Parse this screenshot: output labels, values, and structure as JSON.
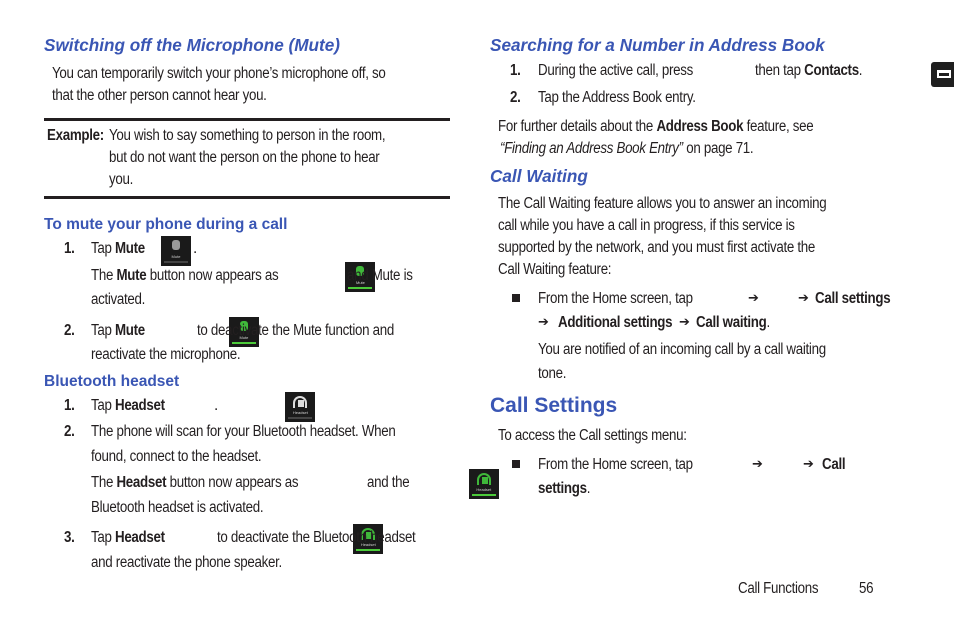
{
  "left": {
    "mute_section": {
      "heading": "Switching off the Microphone (Mute)",
      "intro_line1": "You can temporarily switch your phone’s microphone off, so",
      "intro_line2": "that the other person cannot hear you.",
      "example_label": "Example:",
      "example_line1": "You wish to say something to person in the room,",
      "example_line2": "but do not want the person on the phone to hear",
      "example_line3": "you."
    },
    "mute_steps": {
      "heading": "To mute your phone during a call",
      "step1_num": "1.",
      "step1_pre": "Tap ",
      "step1_bold": "Mute",
      "step1_post": ".",
      "step1_note_pre": "The ",
      "step1_note_bold": "Mute",
      "step1_note_mid": " button now appears as",
      "step1_note_post": "and Mute is",
      "step1_note_line2": "activated.",
      "step2_num": "2.",
      "step2_pre": "Tap ",
      "step2_bold": "Mute",
      "step2_post": "to deactivate the Mute function and",
      "step2_line2": "reactivate the microphone.",
      "icon_label": "Mute"
    },
    "bluetooth": {
      "heading": "Bluetooth headset",
      "step1_num": "1.",
      "step1_pre": "Tap ",
      "step1_bold": "Headset",
      "step1_post": ".",
      "step2_num": "2.",
      "step2_line1": "The phone will scan for your Bluetooth headset. When",
      "step2_line2": "found, connect to the headset.",
      "step2_note_pre": "The ",
      "step2_note_bold": "Headset",
      "step2_note_mid": " button now appears as",
      "step2_note_post": "and the",
      "step2_note_line2": "Bluetooth headset is activated.",
      "step3_num": "3.",
      "step3_pre": "Tap ",
      "step3_bold": "Headset",
      "step3_post": "to deactivate the Bluetooth headset",
      "step3_line2": "and reactivate the phone speaker.",
      "icon_label": "Headset"
    }
  },
  "right": {
    "search": {
      "heading": "Searching for a Number in Address Book",
      "step1_num": "1.",
      "step1_pre": "During the active call, press",
      "step1_mid": "then tap ",
      "step1_bold": "Contacts",
      "step1_post": ".",
      "step2_num": "2.",
      "step2_text": "Tap the Address Book entry.",
      "details_pre": "For further details about the ",
      "details_bold": "Address Book",
      "details_post": " feature, see",
      "details_italic": "“Finding an Address Book Entry”",
      "details_page": " on page 71."
    },
    "call_waiting": {
      "heading": "Call Waiting",
      "para_line1": "The Call Waiting feature allows you to answer an incoming",
      "para_line2": "call while you have a call in progress, if this service is",
      "para_line3": "supported by the network, and you must first activate the",
      "para_line4": "Call Waiting feature:",
      "bullet_pre": "From the Home screen, tap",
      "arrow": "➔",
      "path1": "Call settings",
      "path2": "Additional settings",
      "path3": "Call waiting",
      "bullet_end": ".",
      "note_line1": "You are notified of an incoming call by a call waiting",
      "note_line2": "tone."
    },
    "call_settings": {
      "heading": "Call Settings",
      "intro": "To access the Call settings menu:",
      "bullet_pre": "From the Home screen, tap",
      "arrow": "➔",
      "path_line1": "Call",
      "path_line2": "settings",
      "bullet_end": "."
    }
  },
  "footer": {
    "section": "Call Functions",
    "page": "56"
  },
  "icons": {
    "menu_key": "menu-key-icon",
    "phone_app": "phone-app-icon",
    "mute": "mute-icon",
    "headset": "headset-icon"
  },
  "colors": {
    "heading": "#3a56b4",
    "text": "#231f20",
    "icon_green": "#4ccb3a"
  }
}
